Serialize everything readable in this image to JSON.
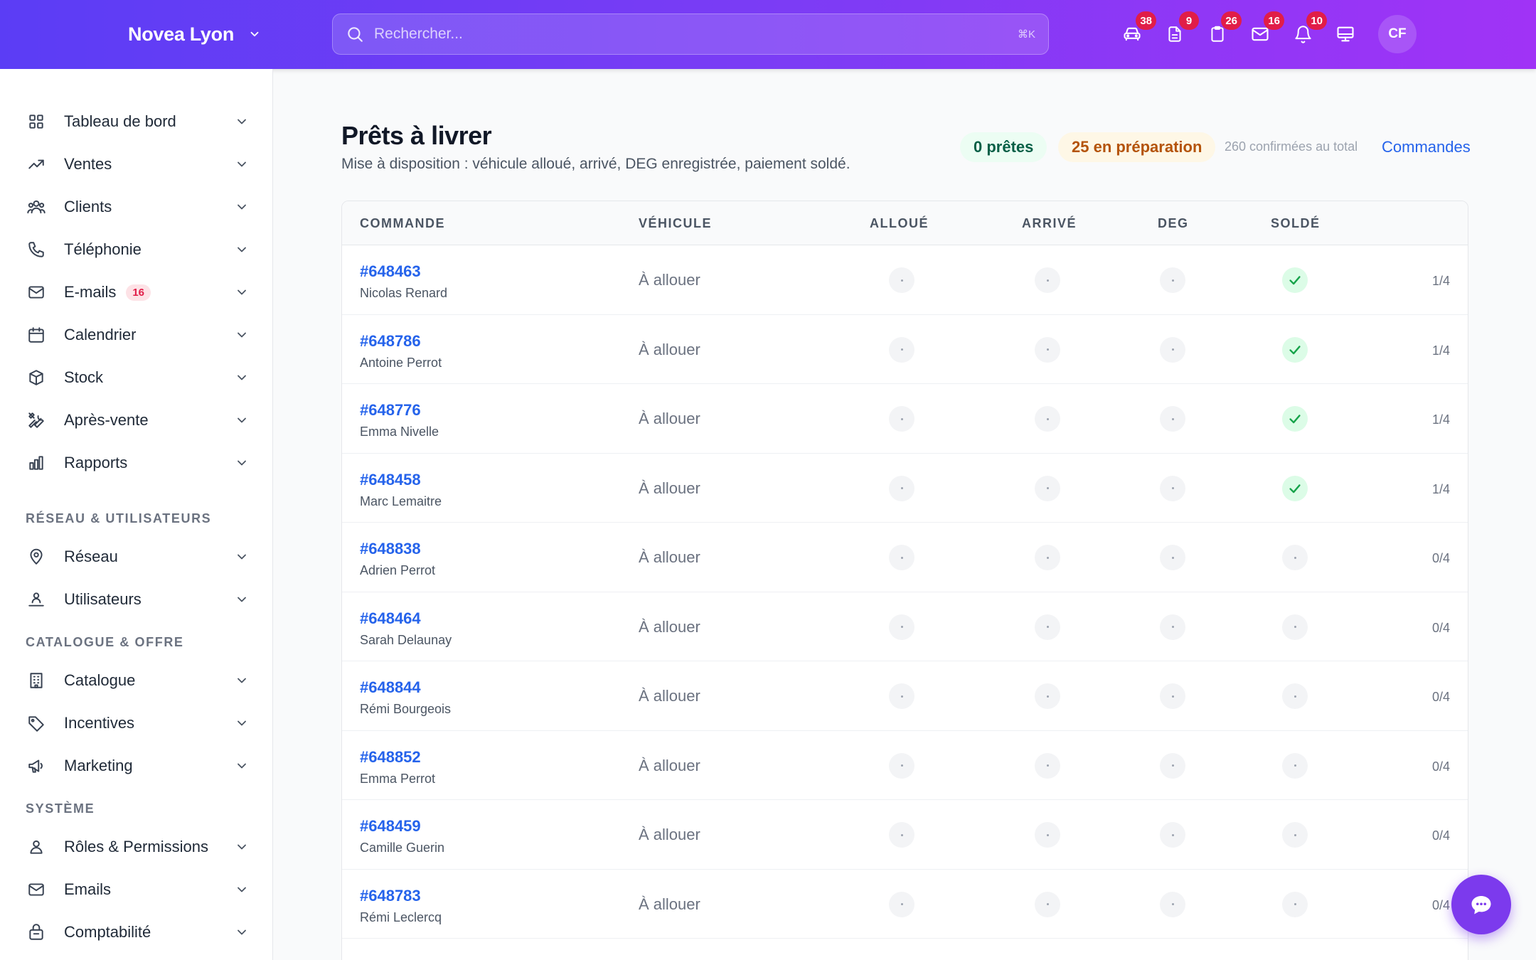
{
  "header": {
    "brand": "Novea Lyon",
    "search_placeholder": "Rechercher...",
    "search_shortcut": "⌘K",
    "icons": [
      {
        "name": "car-icon",
        "badge": "38"
      },
      {
        "name": "document-icon",
        "badge": "9"
      },
      {
        "name": "clipboard-icon",
        "badge": "26"
      },
      {
        "name": "mail-icon",
        "badge": "16"
      },
      {
        "name": "bell-icon",
        "badge": "10"
      },
      {
        "name": "monitor-icon",
        "badge": ""
      }
    ],
    "avatar_initials": "CF"
  },
  "sidebar": {
    "items": [
      {
        "label": "Tableau de bord",
        "icon": "grid-icon"
      },
      {
        "label": "Ventes",
        "icon": "trending-up-icon"
      },
      {
        "label": "Clients",
        "icon": "users-icon"
      },
      {
        "label": "Téléphonie",
        "icon": "phone-icon"
      },
      {
        "label": "E-mails",
        "icon": "mail-icon",
        "badge": "16"
      },
      {
        "label": "Calendrier",
        "icon": "calendar-icon"
      },
      {
        "label": "Stock",
        "icon": "box-icon"
      },
      {
        "label": "Après-vente",
        "icon": "tools-icon"
      },
      {
        "label": "Rapports",
        "icon": "bar-chart-icon"
      }
    ],
    "section_network": "RÉSEAU & UTILISATEURS",
    "network_items": [
      {
        "label": "Réseau",
        "icon": "map-pin-icon"
      },
      {
        "label": "Utilisateurs",
        "icon": "user-network-icon"
      }
    ],
    "section_catalog": "CATALOGUE & OFFRE",
    "catalog_items": [
      {
        "label": "Catalogue",
        "icon": "building-icon"
      },
      {
        "label": "Incentives",
        "icon": "tag-icon"
      },
      {
        "label": "Marketing",
        "icon": "megaphone-icon"
      }
    ],
    "section_system": "SYSTÈME",
    "system_items": [
      {
        "label": "Rôles & Permissions",
        "icon": "user-icon"
      },
      {
        "label": "Emails",
        "icon": "mail-icon"
      },
      {
        "label": "Comptabilité",
        "icon": "lock-bag-icon"
      }
    ]
  },
  "main": {
    "title": "Prêts à livrer",
    "subtitle": "Mise à disposition : véhicule alloué, arrivé, DEG enregistrée, paiement soldé.",
    "ready_chip": "0 prêtes",
    "prep_chip": "25 en préparation",
    "total_text": "260 confirmées au total",
    "orders_link": "Commandes",
    "columns": [
      "COMMANDE",
      "VÉHICULE",
      "ALLOUÉ",
      "ARRIVÉ",
      "DEG",
      "SOLDÉ"
    ],
    "rows": [
      {
        "order": "#648463",
        "customer": "Nicolas Renard",
        "vehicle": "À allouer",
        "allocated": false,
        "arrived": false,
        "deg": false,
        "paid": true,
        "progress": "1/4"
      },
      {
        "order": "#648786",
        "customer": "Antoine Perrot",
        "vehicle": "À allouer",
        "allocated": false,
        "arrived": false,
        "deg": false,
        "paid": true,
        "progress": "1/4"
      },
      {
        "order": "#648776",
        "customer": "Emma Nivelle",
        "vehicle": "À allouer",
        "allocated": false,
        "arrived": false,
        "deg": false,
        "paid": true,
        "progress": "1/4"
      },
      {
        "order": "#648458",
        "customer": "Marc Lemaitre",
        "vehicle": "À allouer",
        "allocated": false,
        "arrived": false,
        "deg": false,
        "paid": true,
        "progress": "1/4"
      },
      {
        "order": "#648838",
        "customer": "Adrien Perrot",
        "vehicle": "À allouer",
        "allocated": false,
        "arrived": false,
        "deg": false,
        "paid": false,
        "progress": "0/4"
      },
      {
        "order": "#648464",
        "customer": "Sarah Delaunay",
        "vehicle": "À allouer",
        "allocated": false,
        "arrived": false,
        "deg": false,
        "paid": false,
        "progress": "0/4"
      },
      {
        "order": "#648844",
        "customer": "Rémi Bourgeois",
        "vehicle": "À allouer",
        "allocated": false,
        "arrived": false,
        "deg": false,
        "paid": false,
        "progress": "0/4"
      },
      {
        "order": "#648852",
        "customer": "Emma Perrot",
        "vehicle": "À allouer",
        "allocated": false,
        "arrived": false,
        "deg": false,
        "paid": false,
        "progress": "0/4"
      },
      {
        "order": "#648459",
        "customer": "Camille Guerin",
        "vehicle": "À allouer",
        "allocated": false,
        "arrived": false,
        "deg": false,
        "paid": false,
        "progress": "0/4"
      },
      {
        "order": "#648783",
        "customer": "Rémi Leclercq",
        "vehicle": "À allouer",
        "allocated": false,
        "arrived": false,
        "deg": false,
        "paid": false,
        "progress": "0/4"
      }
    ]
  },
  "colors": {
    "header_start": "#5b3df5",
    "header_end": "#a033f6",
    "link": "#2563eb",
    "badge": "#e11d48",
    "success": "#16a34a",
    "fab": "#7c3aed"
  }
}
